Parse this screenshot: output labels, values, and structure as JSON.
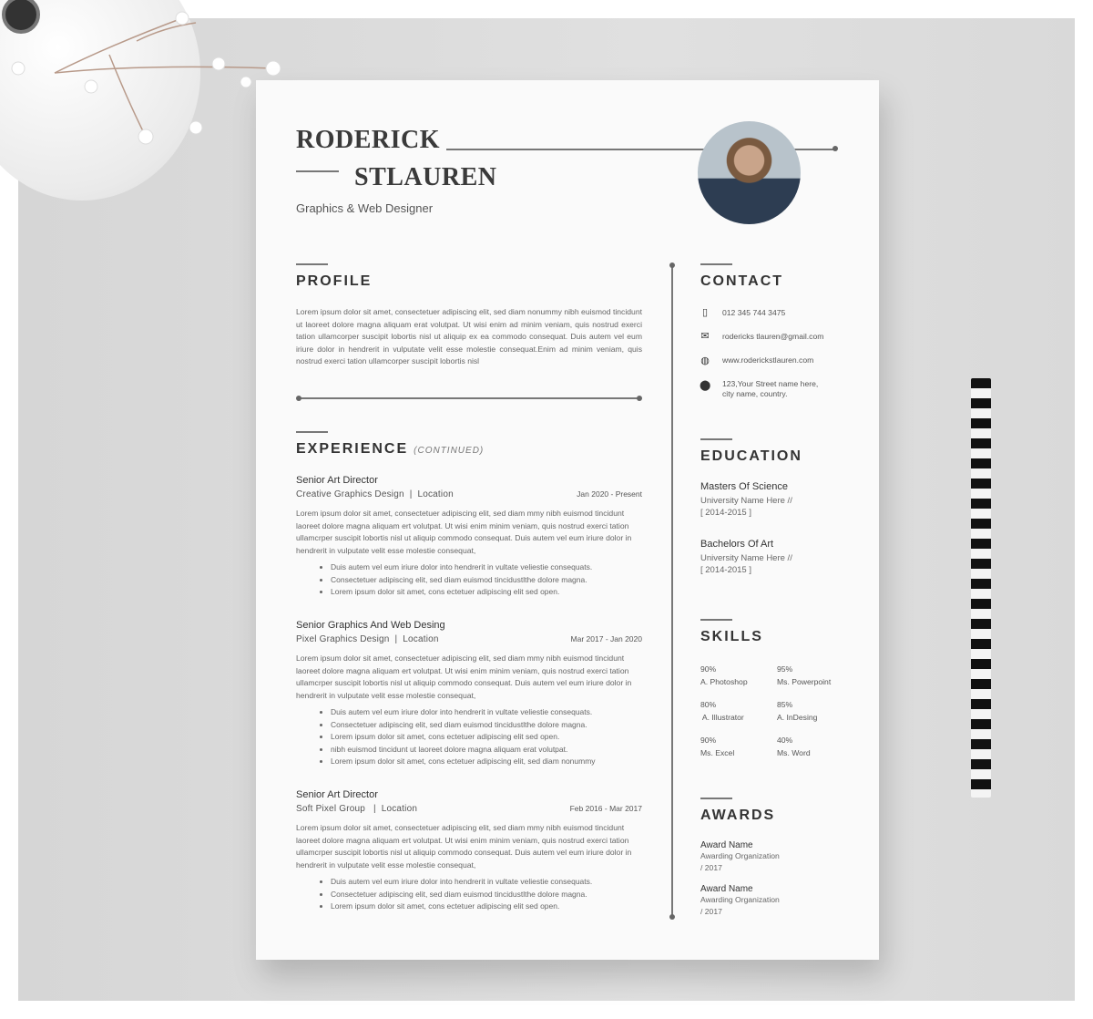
{
  "header": {
    "first_name": "RODERICK",
    "last_name": "STLAUREN",
    "title": "Graphics & Web Designer"
  },
  "profile": {
    "heading": "PROFILE",
    "text": "Lorem ipsum dolor sit amet, consectetuer adipiscing elit, sed diam nonummy nibh euismod tincidunt ut laoreet dolore magna aliquam erat volutpat. Ut wisi enim ad minim veniam, quis nostrud exerci tation ullamcorper suscipit lobortis nisl ut aliquip ex ea commodo consequat. Duis autem vel eum iriure dolor in hendrerit in vulputate velit esse molestie consequat.Enim ad minim veniam, quis nostrud exerci tation ullamcorper suscipit lobortis nisl"
  },
  "experience": {
    "heading": "EXPERIENCE",
    "continued": "(CONTINUED)",
    "jobs": [
      {
        "title": "Senior Art Director",
        "company": "Creative Graphics Design  |  Location",
        "dates": "Jan 2020 - Present",
        "text": "Lorem ipsum dolor sit amet, consectetuer adipiscing elit, sed diam mmy nibh euismod tincidunt laoreet dolore magna aliquam ert volutpat. Ut wisi enim minim veniam, quis nostrud exerci tation ullamcrper suscipit lobortis nisl ut aliquip commodo consequat. Duis autem vel eum iriure dolor in hendrerit in vulputate velit esse molestie consequat,",
        "bullets": [
          "Duis autem vel eum iriure dolor into hendrerit in vultate veliestie consequats.",
          "Consectetuer adipiscing elit, sed diam euismod tincidustlthe dolore magna.",
          "Lorem ipsum dolor sit amet, cons ectetuer adipiscing elit sed open."
        ]
      },
      {
        "title": "Senior Graphics And Web Desing",
        "company": "Pixel Graphics Design  |  Location",
        "dates": "Mar 2017 - Jan 2020",
        "text": "Lorem ipsum dolor sit amet, consectetuer adipiscing elit, sed diam mmy nibh euismod tincidunt laoreet dolore magna aliquam ert volutpat. Ut wisi enim minim veniam, quis nostrud exerci tation ullamcrper suscipit lobortis nisl ut aliquip commodo consequat. Duis autem vel eum iriure dolor in hendrerit in vulputate velit esse molestie consequat,",
        "bullets": [
          "Duis autem vel eum iriure dolor into hendrerit in vultate veliestie consequats.",
          "Consectetuer adipiscing elit, sed diam euismod tincidustlthe dolore magna.",
          "Lorem ipsum dolor sit amet, cons ectetuer adipiscing elit sed open.",
          "nibh euismod tincidunt ut laoreet dolore magna aliquam erat volutpat.",
          "Lorem ipsum dolor sit amet, cons ectetuer adipiscing elit, sed diam nonummy"
        ]
      },
      {
        "title": "Senior Art Director",
        "company": "Soft Pixel Group   |  Location",
        "dates": "Feb 2016 - Mar 2017",
        "text": "Lorem ipsum dolor sit amet, consectetuer adipiscing elit, sed diam mmy nibh euismod tincidunt laoreet dolore magna aliquam ert volutpat. Ut wisi enim minim veniam, quis nostrud exerci tation ullamcrper suscipit lobortis nisl ut aliquip commodo consequat. Duis autem vel eum iriure dolor in hendrerit in vulputate velit esse molestie consequat,",
        "bullets": [
          "Duis autem vel eum iriure dolor into hendrerit in vultate veliestie consequats.",
          "Consectetuer adipiscing elit, sed diam euismod tincidustlthe dolore magna.",
          "Lorem ipsum dolor sit amet, cons ectetuer adipiscing elit sed open."
        ]
      }
    ]
  },
  "contact": {
    "heading": "CONTACT",
    "phone": "012 345 744 3475",
    "email": "rodericks tlauren@gmail.com",
    "website": "www.roderickstlauren.com",
    "address_line1": "123,Your Street name here,",
    "address_line2": "city name, country.",
    "icons": [
      "phone-icon",
      "mail-icon",
      "globe-icon",
      "location-pin-icon"
    ]
  },
  "education": {
    "heading": "EDUCATION",
    "items": [
      {
        "degree": "Masters Of Science",
        "school": "University Name Here //",
        "years": "[ 2014-2015 ]"
      },
      {
        "degree": "Bachelors Of Art",
        "school": "University Name Here //",
        "years": "[ 2014-2015 ]"
      }
    ]
  },
  "skills": {
    "heading": "SKILLS",
    "items": [
      {
        "pct": "90%",
        "name": "A. Photoshop"
      },
      {
        "pct": "95%",
        "name": "Ms. Powerpoint"
      },
      {
        "pct": "80%",
        "name": " A. Illustrator"
      },
      {
        "pct": "85%",
        "name": "A. InDesing"
      },
      {
        "pct": "90%",
        "name": "Ms. Excel"
      },
      {
        "pct": "40%",
        "name": "Ms. Word"
      }
    ]
  },
  "awards": {
    "heading": "AWARDS",
    "items": [
      {
        "name": "Award Name",
        "org": "Awarding Organization",
        "year": "/  2017"
      },
      {
        "name": "Award Name",
        "org": "Awarding Organization",
        "year": "/ 2017"
      }
    ]
  }
}
